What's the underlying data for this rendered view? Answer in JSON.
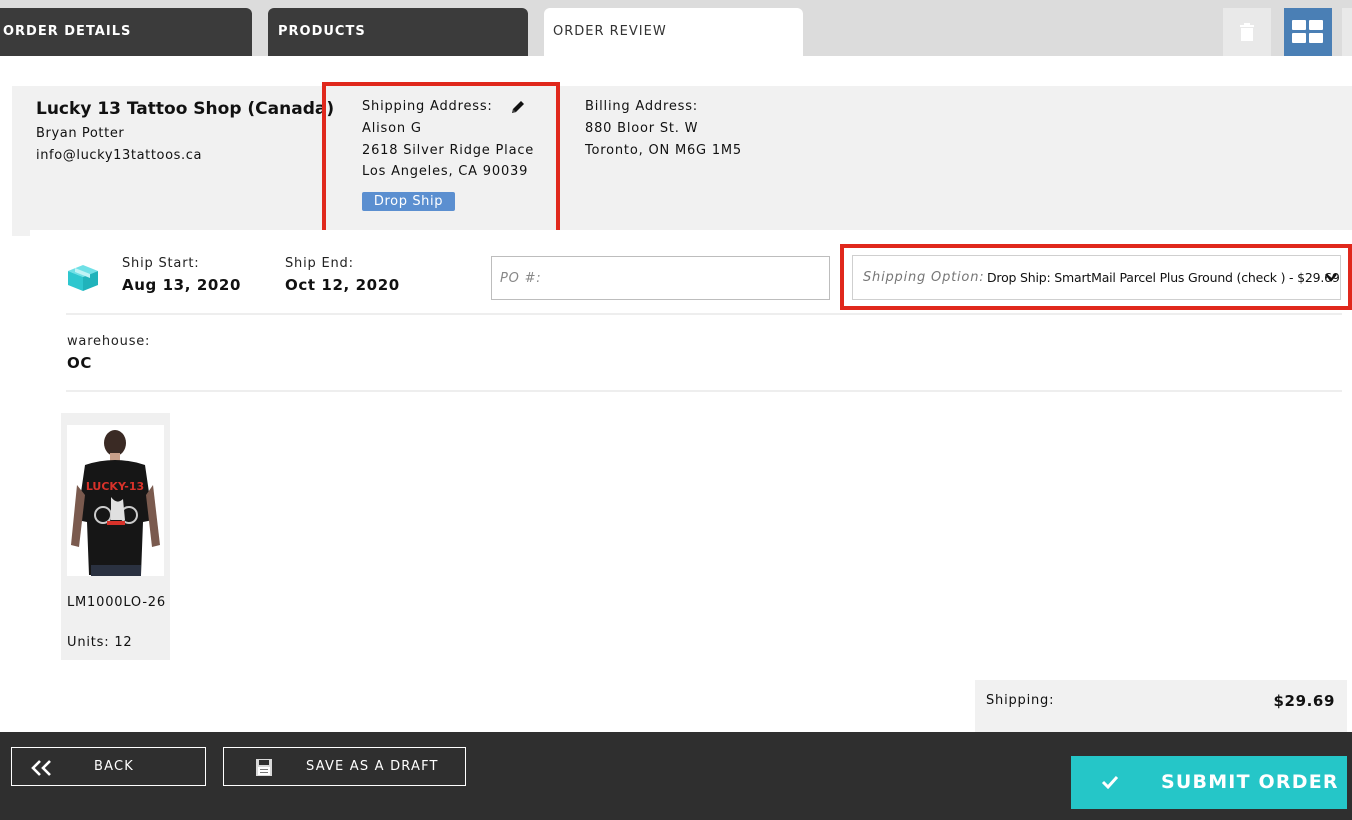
{
  "tabs": [
    {
      "label": "ORDER DETAILS"
    },
    {
      "label": "PRODUCTS"
    },
    {
      "label": "ORDER REVIEW"
    }
  ],
  "customer": {
    "shop_name": "Lucky 13 Tattoo Shop (Canada)",
    "contact_name": "Bryan Potter",
    "email": "info@lucky13tattoos.ca"
  },
  "shipping_address": {
    "label": "Shipping Address:",
    "name": "Alison G",
    "street": "2618 Silver Ridge Place",
    "city": "Los Angeles, CA 90039",
    "badge": "Drop Ship"
  },
  "billing_address": {
    "label": "Billing Address:",
    "street": "880 Bloor St. W",
    "city": "Toronto, ON M6G 1M5"
  },
  "ship_dates": {
    "start_label": "Ship Start:",
    "start_value": "Aug 13, 2020",
    "end_label": "Ship End:",
    "end_value": "Oct 12, 2020"
  },
  "po": {
    "placeholder": "PO #:",
    "value": ""
  },
  "shipping_option": {
    "label": "Shipping Option:",
    "selected": "Drop Ship: SmartMail Parcel Plus Ground (check ) - $29.69"
  },
  "warehouse": {
    "label": "warehouse:",
    "value": "OC"
  },
  "products": [
    {
      "sku": "LM1000LO-26",
      "units_label": "Units: 12",
      "image_text": "LUCKY-13"
    }
  ],
  "summary": {
    "shipping_label": "Shipping:",
    "shipping_value": "$29.69"
  },
  "footer": {
    "back_label": "BACK",
    "draft_label": "SAVE AS A DRAFT",
    "submit_label": "SUBMIT ORDER"
  },
  "colors": {
    "highlight": "#e0281c",
    "accent_blue": "#4a7fb5",
    "badge_blue": "#5b8fd0",
    "submit_teal": "#25c6c8",
    "icon_teal": "#2ec7cf",
    "dark_tab": "#3b3b3b",
    "footer_bg": "#2f2f2f"
  },
  "icons": [
    "trash-icon",
    "grid-view-icon",
    "pencil-icon",
    "package-icon",
    "chevron-down-icon",
    "double-chevron-left-icon",
    "save-disk-icon",
    "checkmark-icon"
  ]
}
